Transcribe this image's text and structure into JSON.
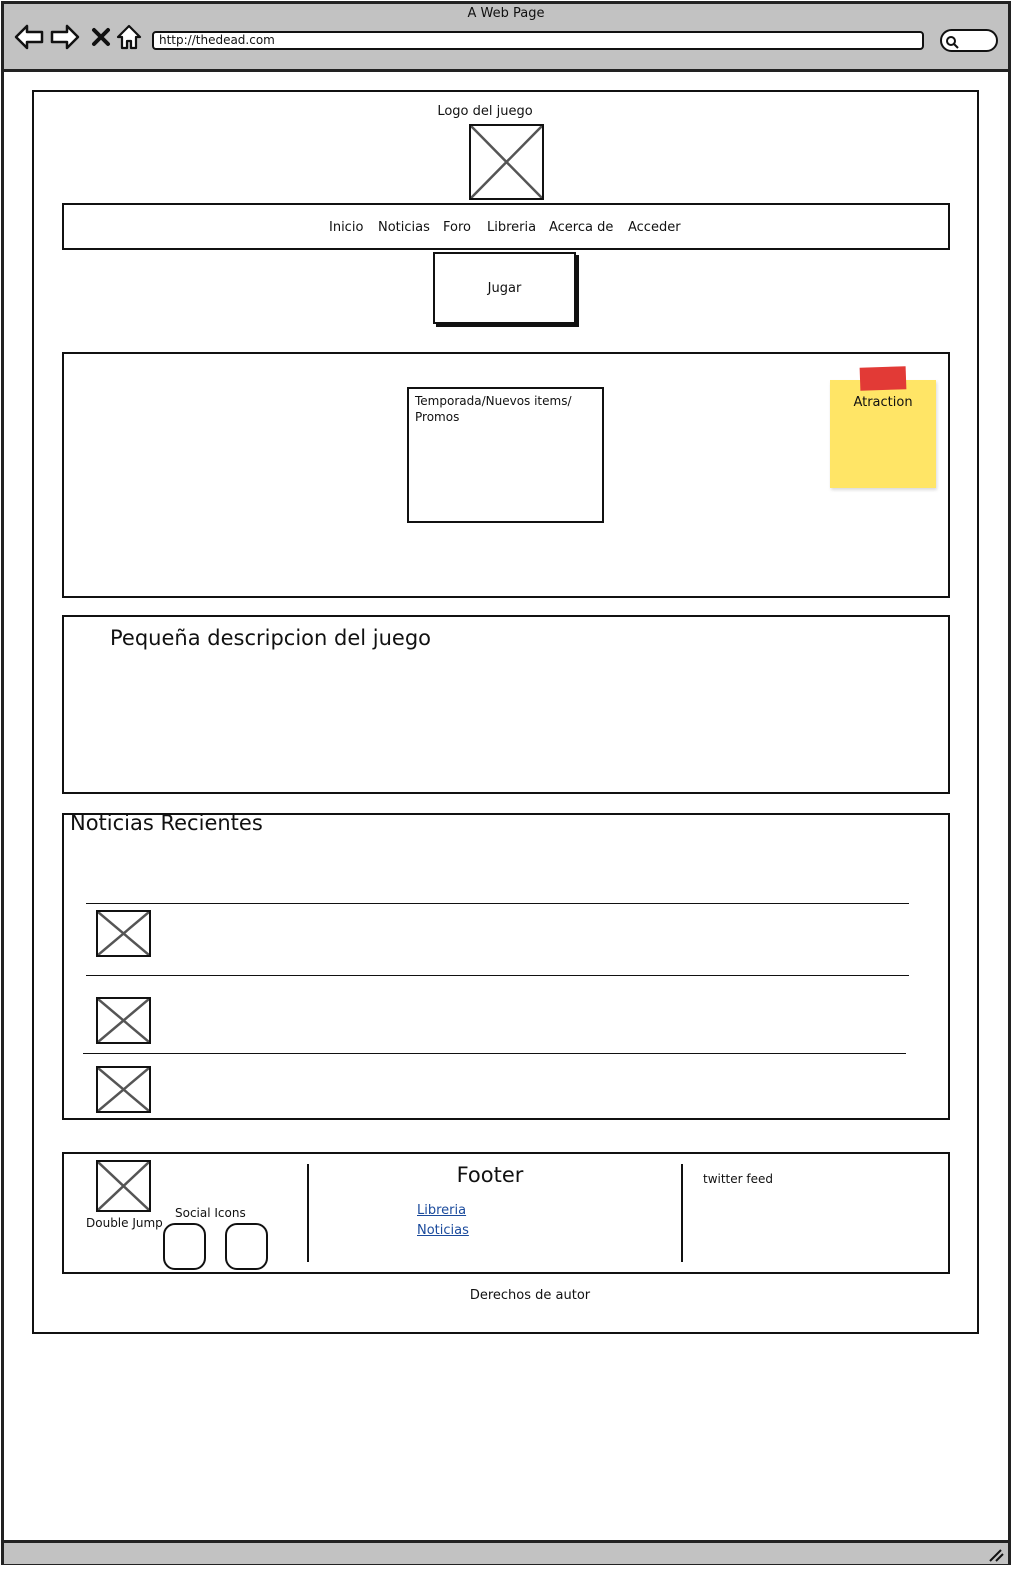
{
  "window": {
    "title": "A Web Page",
    "url": "http://thedead.com"
  },
  "icons": {
    "back": "back-arrow-icon",
    "forward": "forward-arrow-icon",
    "stop": "close-icon",
    "home": "home-icon",
    "search": "search-icon",
    "resize": "resize-grip-icon"
  },
  "header": {
    "logo_label": "Logo del juego"
  },
  "nav": {
    "items": [
      "Inicio",
      "Noticias",
      "Foro",
      "Libreria",
      "Acerca de",
      "Acceder"
    ]
  },
  "play_button": {
    "label": "Jugar"
  },
  "promo": {
    "text": "Temporada/Nuevos items/ Promos",
    "sticky_note": "Atraction",
    "sticky_colors": {
      "note": "#ffe566",
      "tape": "#e23a36"
    }
  },
  "description": {
    "title": "Pequeña descripcion del juego"
  },
  "news": {
    "title": "Noticias Recientes"
  },
  "footer": {
    "studio_label": "Double Jump",
    "social_label": "Social Icons",
    "title": "Footer",
    "links": [
      "Libreria",
      "Noticias"
    ],
    "twitter": "twitter feed",
    "link_color": "#1a4a9c"
  },
  "copyright": "Derechos de autor"
}
